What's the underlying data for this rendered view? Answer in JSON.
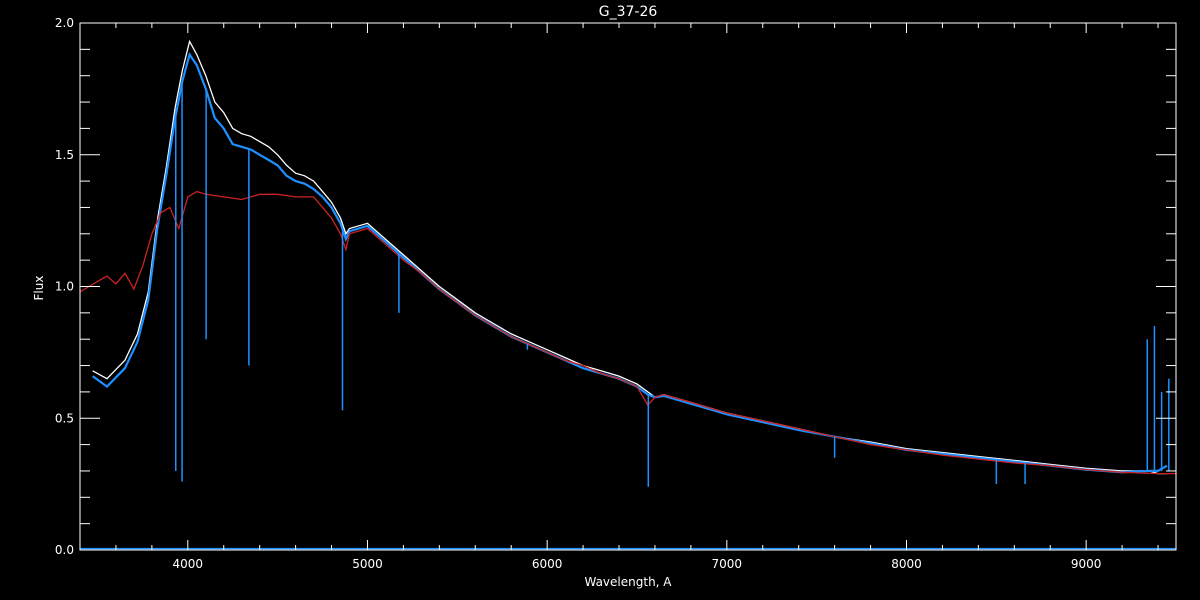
{
  "chart_data": {
    "type": "line",
    "title": "G_37-26",
    "xlabel": "Wavelength, A",
    "ylabel": "Flux",
    "xlim": [
      3400,
      9500
    ],
    "ylim": [
      0.0,
      2.0
    ],
    "x_ticks": [
      4000,
      5000,
      6000,
      7000,
      8000,
      9000
    ],
    "x_tick_labels": [
      "4000",
      "5000",
      "6000",
      "7000",
      "8000",
      "9000"
    ],
    "x_minor_step": 200,
    "y_ticks": [
      0.0,
      0.5,
      1.0,
      1.5,
      2.0
    ],
    "y_tick_labels": [
      "0.0",
      "0.5",
      "1.0",
      "1.5",
      "2.0"
    ],
    "y_minor_step": 0.1,
    "grid": false,
    "colors": {
      "background": "#000000",
      "axes": "#ffffff"
    },
    "series": [
      {
        "color": "#ffffff",
        "x": [
          3470,
          3550,
          3650,
          3720,
          3780,
          3830,
          3880,
          3930,
          3970,
          4010,
          4050,
          4100,
          4150,
          4200,
          4250,
          4300,
          4350,
          4400,
          4450,
          4500,
          4550,
          4600,
          4650,
          4700,
          4750,
          4800,
          4850,
          4880,
          4900,
          5000,
          5100,
          5200,
          5300,
          5400,
          5500,
          5600,
          5700,
          5800,
          5900,
          6000,
          6100,
          6200,
          6300,
          6400,
          6500,
          6560,
          6600,
          6650,
          6700,
          6800,
          6900,
          7000,
          7200,
          7400,
          7600,
          7800,
          8000,
          8200,
          8400,
          8600,
          8800,
          9000,
          9200,
          9350,
          9400,
          9450
        ],
        "y": [
          0.68,
          0.65,
          0.72,
          0.82,
          0.98,
          1.25,
          1.45,
          1.68,
          1.82,
          1.93,
          1.88,
          1.8,
          1.7,
          1.66,
          1.6,
          1.58,
          1.57,
          1.55,
          1.53,
          1.5,
          1.46,
          1.43,
          1.42,
          1.4,
          1.36,
          1.32,
          1.26,
          1.2,
          1.22,
          1.24,
          1.18,
          1.12,
          1.06,
          1.0,
          0.95,
          0.9,
          0.86,
          0.82,
          0.79,
          0.76,
          0.73,
          0.7,
          0.68,
          0.66,
          0.63,
          0.6,
          0.58,
          0.59,
          0.58,
          0.56,
          0.54,
          0.52,
          0.49,
          0.46,
          0.43,
          0.41,
          0.385,
          0.37,
          0.355,
          0.34,
          0.325,
          0.31,
          0.3,
          0.3,
          0.29,
          0.29
        ]
      },
      {
        "color": "#1e90ff",
        "x": [
          3470,
          3550,
          3650,
          3720,
          3780,
          3830,
          3880,
          3930,
          3970,
          4010,
          4050,
          4100,
          4150,
          4200,
          4250,
          4300,
          4350,
          4400,
          4450,
          4500,
          4550,
          4600,
          4650,
          4700,
          4750,
          4800,
          4850,
          4880,
          4900,
          5000,
          5100,
          5200,
          5300,
          5400,
          5500,
          5600,
          5700,
          5800,
          5900,
          6000,
          6100,
          6200,
          6300,
          6400,
          6500,
          6560,
          6600,
          6650,
          6700,
          6800,
          6900,
          7000,
          7200,
          7400,
          7600,
          7800,
          8000,
          8200,
          8400,
          8600,
          8800,
          9000,
          9200,
          9350,
          9400,
          9450
        ],
        "y": [
          0.66,
          0.62,
          0.69,
          0.79,
          0.95,
          1.22,
          1.42,
          1.64,
          1.78,
          1.88,
          1.84,
          1.75,
          1.64,
          1.6,
          1.54,
          1.53,
          1.52,
          1.5,
          1.48,
          1.46,
          1.42,
          1.4,
          1.39,
          1.37,
          1.34,
          1.3,
          1.24,
          1.18,
          1.21,
          1.23,
          1.17,
          1.11,
          1.05,
          0.99,
          0.94,
          0.89,
          0.85,
          0.81,
          0.78,
          0.75,
          0.72,
          0.69,
          0.67,
          0.65,
          0.62,
          0.59,
          0.58,
          0.585,
          0.575,
          0.555,
          0.535,
          0.515,
          0.485,
          0.455,
          0.43,
          0.405,
          0.38,
          0.365,
          0.35,
          0.335,
          0.32,
          0.305,
          0.295,
          0.3,
          0.3,
          0.32
        ]
      },
      {
        "color": "#cc2222",
        "x": [
          3400,
          3450,
          3500,
          3550,
          3600,
          3650,
          3700,
          3750,
          3800,
          3850,
          3900,
          3950,
          4000,
          4050,
          4100,
          4200,
          4300,
          4400,
          4500,
          4600,
          4700,
          4750,
          4800,
          4850,
          4880,
          4900,
          5000,
          5100,
          5200,
          5300,
          5400,
          5500,
          5600,
          5700,
          5800,
          5900,
          6000,
          6100,
          6200,
          6300,
          6400,
          6500,
          6560,
          6600,
          6650,
          6700,
          6800,
          6900,
          7000,
          7200,
          7400,
          7600,
          7800,
          8000,
          8200,
          8400,
          8600,
          8800,
          9000,
          9200,
          9400,
          9500
        ],
        "y": [
          0.98,
          1.0,
          1.02,
          1.04,
          1.01,
          1.05,
          0.99,
          1.08,
          1.2,
          1.28,
          1.3,
          1.22,
          1.34,
          1.36,
          1.35,
          1.34,
          1.33,
          1.35,
          1.35,
          1.34,
          1.34,
          1.3,
          1.26,
          1.2,
          1.14,
          1.2,
          1.22,
          1.16,
          1.1,
          1.05,
          0.99,
          0.94,
          0.89,
          0.85,
          0.81,
          0.78,
          0.75,
          0.72,
          0.7,
          0.67,
          0.65,
          0.62,
          0.55,
          0.58,
          0.59,
          0.58,
          0.56,
          0.54,
          0.52,
          0.49,
          0.46,
          0.43,
          0.4,
          0.38,
          0.36,
          0.345,
          0.33,
          0.32,
          0.305,
          0.295,
          0.29,
          0.29
        ]
      }
    ],
    "spectral_lines": [
      {
        "x": 3933,
        "y": 0.3
      },
      {
        "x": 3968,
        "y": 0.26
      },
      {
        "x": 4102,
        "y": 0.8
      },
      {
        "x": 4340,
        "y": 0.7
      },
      {
        "x": 4861,
        "y": 0.53
      },
      {
        "x": 5175,
        "y": 0.9
      },
      {
        "x": 5890,
        "y": 0.76
      },
      {
        "x": 6563,
        "y": 0.24
      },
      {
        "x": 7600,
        "y": 0.35
      },
      {
        "x": 8500,
        "y": 0.25
      },
      {
        "x": 8660,
        "y": 0.25
      }
    ],
    "sky_spikes": [
      {
        "x": 9340,
        "y": 0.8
      },
      {
        "x": 9380,
        "y": 0.85
      },
      {
        "x": 9420,
        "y": 0.6
      },
      {
        "x": 9460,
        "y": 0.65
      }
    ]
  }
}
